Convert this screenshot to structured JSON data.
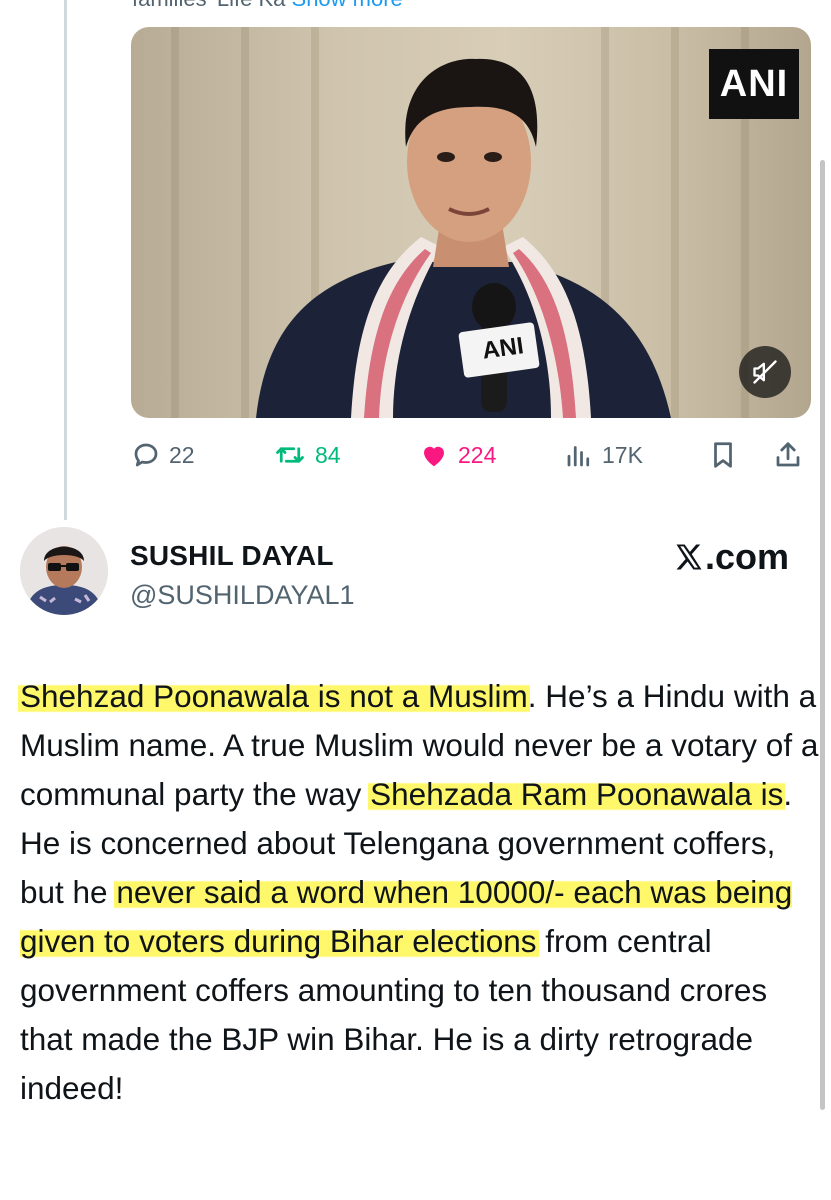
{
  "previous_post": {
    "clipped_text": "families' Life Ka",
    "show_more_label": "Show more",
    "video": {
      "watermark": "ANI",
      "mic_label": "ANI",
      "mute_icon": "speaker-muted-icon"
    },
    "actions": {
      "replies": "22",
      "reposts": "84",
      "likes": "224",
      "views": "17K"
    }
  },
  "post": {
    "display_name": "SUSHIL DAYAL",
    "handle": "@SUSHILDAYAL1",
    "site_label": ".com",
    "body_segments": [
      {
        "text": "Shehzad Poonawala is not a Muslim",
        "highlight": true
      },
      {
        "text": ". He’s a Hindu with a Muslim name. A true Muslim would never be a votary of a communal party the way ",
        "highlight": false
      },
      {
        "text": "Shehzada Ram Poonawala is",
        "highlight": true
      },
      {
        "text": ". He is concerned about Telengana government coffers, but he ",
        "highlight": false
      },
      {
        "text": "never said a word when 10000/- each was being given to voters during Bihar elections",
        "highlight": true
      },
      {
        "text": " from central government  coffers amounting to ten thousand crores that made the BJP win Bihar. He is a dirty retrograde indeed!",
        "highlight": false
      }
    ]
  },
  "colors": {
    "text": "#0f1419",
    "secondary": "#536471",
    "repost": "#00ba7c",
    "like": "#f91880",
    "highlight": "#fff650"
  }
}
